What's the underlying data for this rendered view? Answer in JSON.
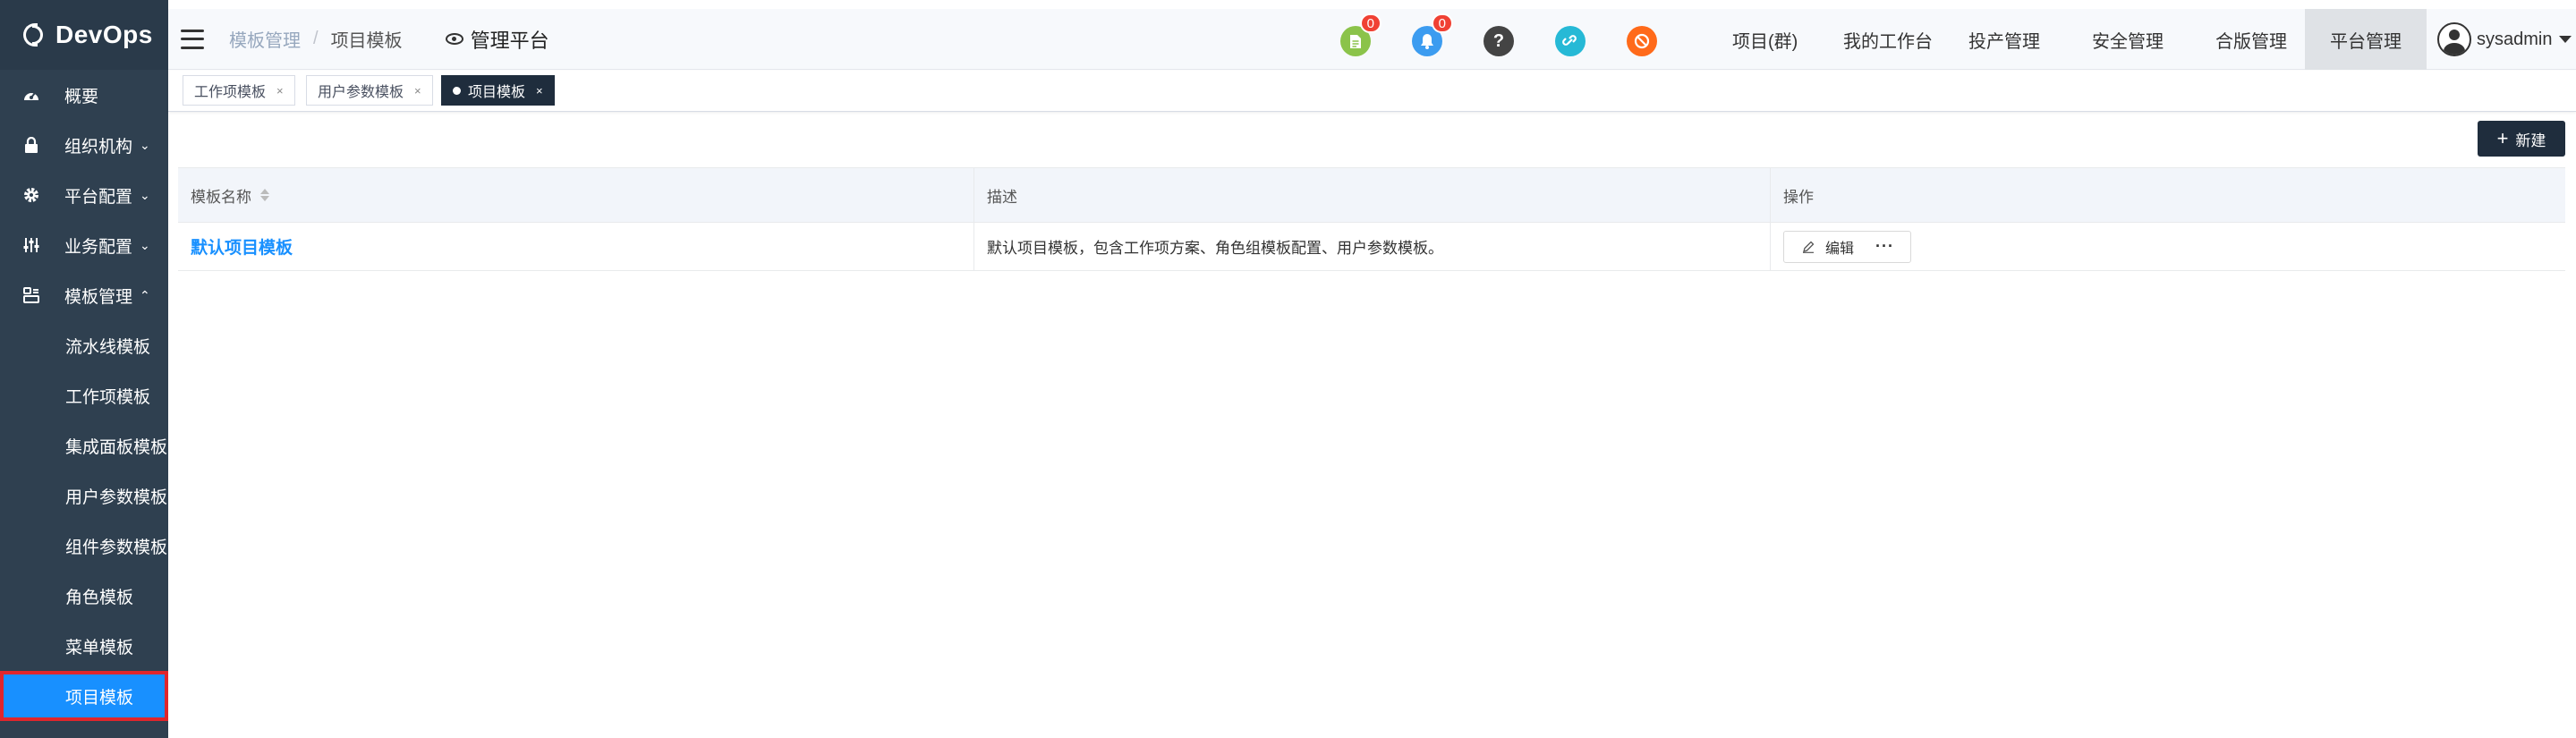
{
  "app": {
    "logo_text": "DevOps"
  },
  "sidebar": {
    "items": [
      {
        "label": "概要",
        "icon": "dashboard-icon"
      },
      {
        "label": "组织机构",
        "icon": "lock-icon",
        "chevron": "⌄"
      },
      {
        "label": "平台配置",
        "icon": "gear-icon",
        "chevron": "⌄"
      },
      {
        "label": "业务配置",
        "icon": "sliders-icon",
        "chevron": "⌄"
      },
      {
        "label": "模板管理",
        "icon": "template-icon",
        "chevron": "⌃"
      }
    ],
    "sub_items": [
      {
        "label": "流水线模板"
      },
      {
        "label": "工作项模板"
      },
      {
        "label": "集成面板模板"
      },
      {
        "label": "用户参数模板"
      },
      {
        "label": "组件参数模板"
      },
      {
        "label": "角色模板"
      },
      {
        "label": "菜单模板"
      },
      {
        "label": "项目模板"
      }
    ]
  },
  "header": {
    "breadcrumb": [
      "模板管理",
      "/",
      "项目模板"
    ],
    "platform_label": "管理平台",
    "icons": [
      {
        "name": "document-icon",
        "color": "#8bc34a",
        "badge": "0"
      },
      {
        "name": "bell-icon",
        "color": "#3c9cf0",
        "badge": "0"
      },
      {
        "name": "help-icon",
        "color": "#444444",
        "glyph": "?"
      },
      {
        "name": "link-icon",
        "color": "#26b9d6"
      },
      {
        "name": "block-icon",
        "color": "#ff6a1a"
      }
    ],
    "nav": [
      "项目(群)",
      "我的工作台",
      "投产管理",
      "安全管理",
      "合版管理",
      "平台管理"
    ],
    "user": "sysadmin"
  },
  "tags": [
    {
      "label": "工作项模板",
      "close": "×"
    },
    {
      "label": "用户参数模板",
      "close": "×"
    },
    {
      "label": "项目模板",
      "close": "×"
    }
  ],
  "toolbar": {
    "new_label": "新建",
    "new_glyph": "+"
  },
  "table": {
    "headers": [
      "模板名称",
      "描述",
      "操作"
    ],
    "rows": [
      {
        "name": "默认项目模板",
        "description": "默认项目模板，包含工作项方案、角色组模板配置、用户参数模板。",
        "edit_label": "编辑",
        "more_label": "···"
      }
    ]
  },
  "colors": {
    "sidebar_bg": "#2f4050",
    "active_blue": "#1890ff",
    "highlight_red": "#e0262c",
    "dark_tag": "#1f2d3d"
  }
}
